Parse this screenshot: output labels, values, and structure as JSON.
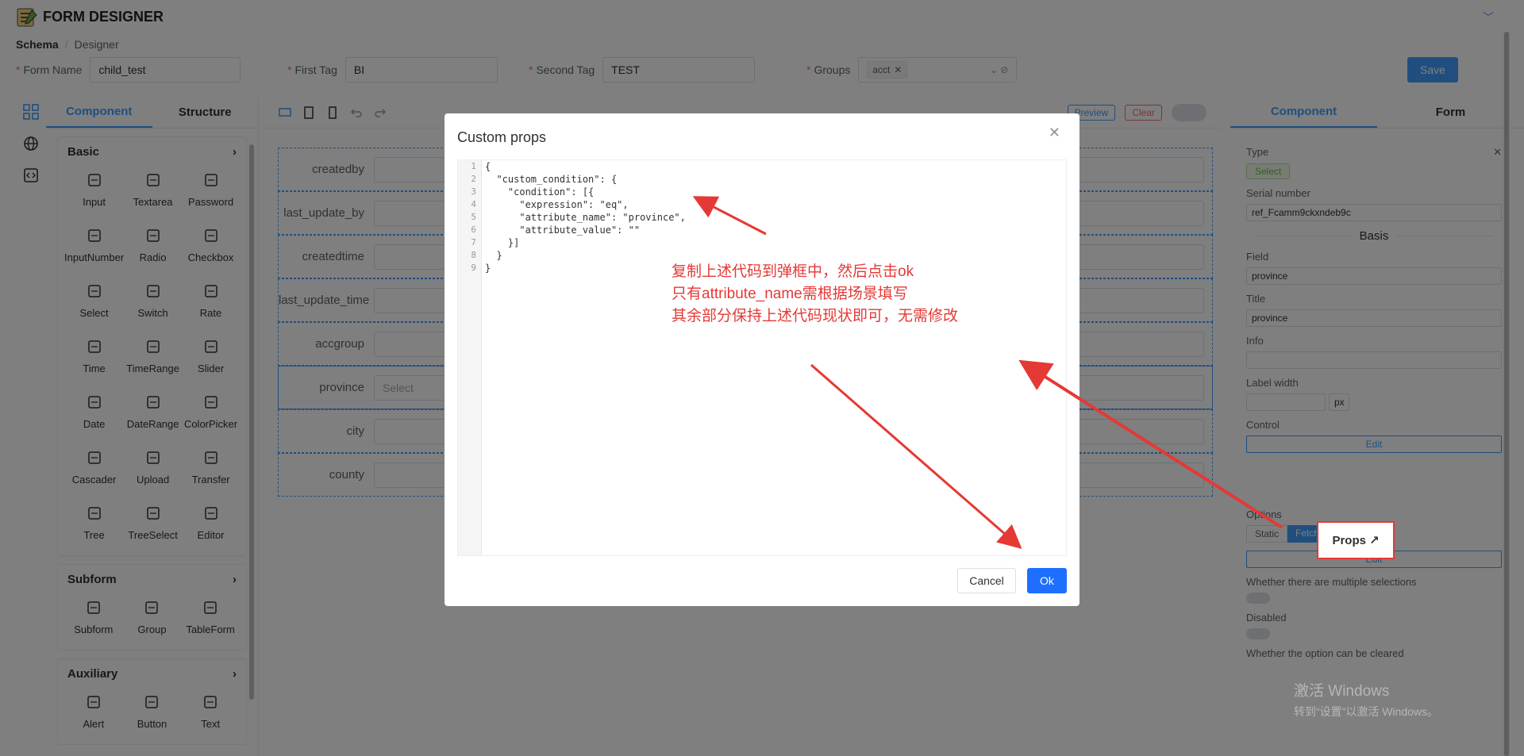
{
  "app": {
    "title": "FORM DESIGNER"
  },
  "breadcrumb": {
    "root": "Schema",
    "current": "Designer"
  },
  "form_meta": {
    "form_name": {
      "label": "Form Name",
      "value": "child_test"
    },
    "first_tag": {
      "label": "First Tag",
      "value": "BI"
    },
    "second_tag": {
      "label": "Second Tag",
      "value": "TEST"
    },
    "groups": {
      "label": "Groups",
      "tag": "acct"
    },
    "save_label": "Save"
  },
  "left_panel": {
    "tabs": [
      "Component",
      "Structure"
    ],
    "basic": {
      "title": "Basic",
      "items": [
        "Input",
        "Textarea",
        "Password",
        "InputNumber",
        "Radio",
        "Checkbox",
        "Select",
        "Switch",
        "Rate",
        "Time",
        "TimeRange",
        "Slider",
        "Date",
        "DateRange",
        "ColorPicker",
        "Cascader",
        "Upload",
        "Transfer",
        "Tree",
        "TreeSelect",
        "Editor"
      ]
    },
    "subform": {
      "title": "Subform",
      "items": [
        "Subform",
        "Group",
        "TableForm"
      ]
    },
    "auxiliary": {
      "title": "Auxiliary",
      "items": [
        "Alert",
        "Button",
        "Text"
      ]
    }
  },
  "toolbar": {
    "preview_label": "Preview",
    "clear_label": "Clear"
  },
  "canvas": {
    "fields": [
      {
        "label": "createdby",
        "placeholder": ""
      },
      {
        "label": "last_update_by",
        "placeholder": ""
      },
      {
        "label": "createdtime",
        "placeholder": ""
      },
      {
        "label": "last_update_time",
        "placeholder": ""
      },
      {
        "label": "accgroup",
        "placeholder": ""
      },
      {
        "label": "province",
        "placeholder": "Select"
      },
      {
        "label": "city",
        "placeholder": ""
      },
      {
        "label": "county",
        "placeholder": ""
      }
    ]
  },
  "right_panel": {
    "tabs": [
      "Component",
      "Form"
    ],
    "type_label": "Type",
    "type_value": "Select",
    "serial_label": "Serial number",
    "serial_value": "ref_Fcamm9ckxndeb9c",
    "basis_label": "Basis",
    "field_label": "Field",
    "field_value": "province",
    "title_label": "Title",
    "title_value": "province",
    "info_label": "Info",
    "label_width_label": "Label width",
    "label_width_unit": "px",
    "control_label": "Control",
    "edit_label": "Edit",
    "props_label": "Props",
    "options_label": "Options",
    "options_static": "Static",
    "options_fetch": "Fetch",
    "multiple_label": "Whether there are multiple selections",
    "disabled_label": "Disabled",
    "clearable_label": "Whether the option can be cleared"
  },
  "modal": {
    "title": "Custom props",
    "code_lines": [
      "{",
      "  \"custom_condition\": {",
      "    \"condition\": [{",
      "      \"expression\": \"eq\",",
      "      \"attribute_name\": \"province\",",
      "      \"attribute_value\": \"\"",
      "    }]",
      "  }",
      "}"
    ],
    "note_lines": [
      "复制上述代码到弹框中，然后点击ok",
      "只有attribute_name需根据场景填写",
      "其余部分保持上述代码现状即可，无需修改"
    ],
    "cancel_label": "Cancel",
    "ok_label": "Ok"
  },
  "watermark": {
    "line1": "激活 Windows",
    "line2": "转到“设置”以激活 Windows。"
  },
  "colors": {
    "accent": "#409eff",
    "annotation": "#e53935",
    "ok": "#1e6fff"
  }
}
